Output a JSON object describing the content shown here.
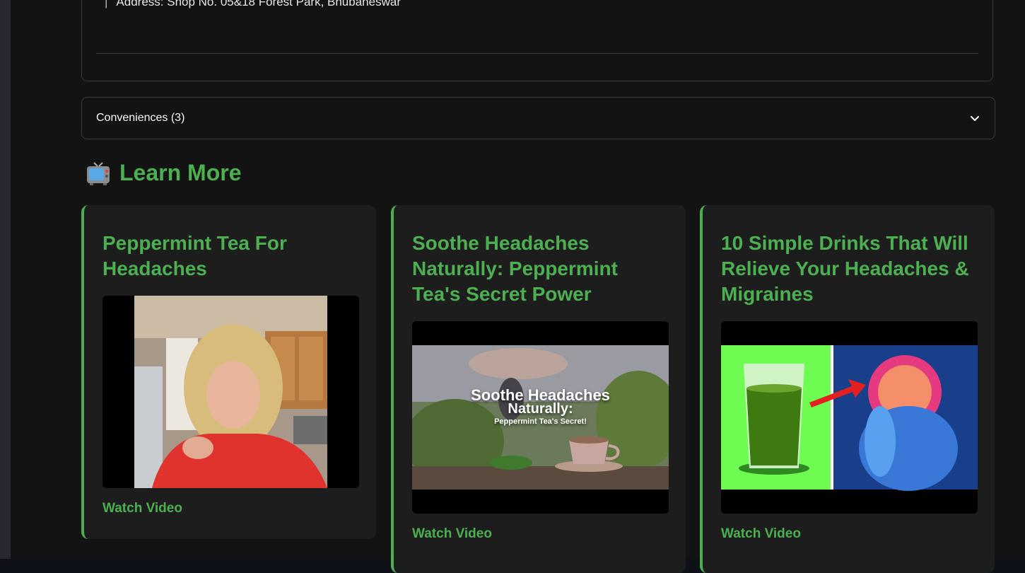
{
  "address": {
    "text": "Address: Shop No. 05&18 Forest Park, Bhubaneswar"
  },
  "expander": {
    "label": "Conveniences (3)"
  },
  "learn_more": {
    "title": "Learn More",
    "icon": "television-icon"
  },
  "cards": [
    {
      "title": "Peppermint Tea For Headaches",
      "link_label": "Watch Video"
    },
    {
      "title": "Soothe Headaches Naturally: Peppermint Tea's Secret Power",
      "link_label": "Watch Video",
      "thumb_text": {
        "line1": "Soothe Headaches",
        "line2": "Naturally:",
        "line3": "Peppermint Tea's Secret!"
      }
    },
    {
      "title": "10 Simple Drinks That Will Relieve Your Headaches & Migraines",
      "link_label": "Watch Video"
    }
  ],
  "colors": {
    "accent": "#4caf50",
    "background": "#131313",
    "card": "#1d1d1e",
    "border": "#3a3b41"
  }
}
